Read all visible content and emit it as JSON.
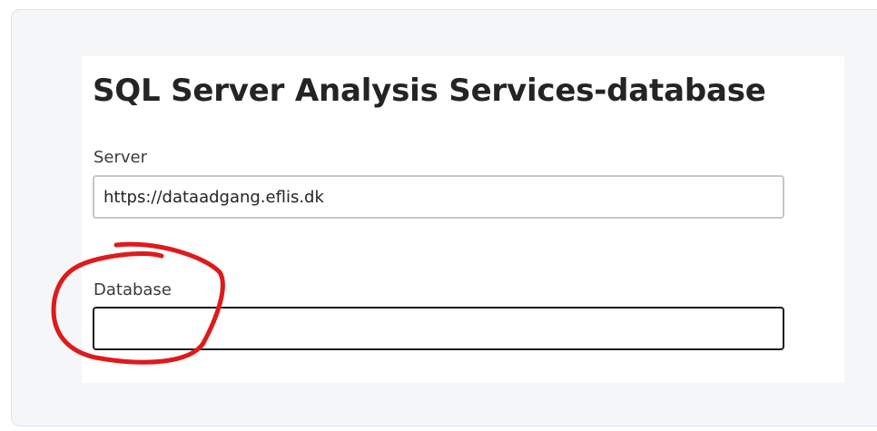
{
  "dialog": {
    "title": "SQL Server Analysis Services-database",
    "server": {
      "label": "Server",
      "value": "https://dataadgang.eflis.dk"
    },
    "database": {
      "label": "Database",
      "value": ""
    }
  },
  "annotation": {
    "color": "#e0191b"
  }
}
